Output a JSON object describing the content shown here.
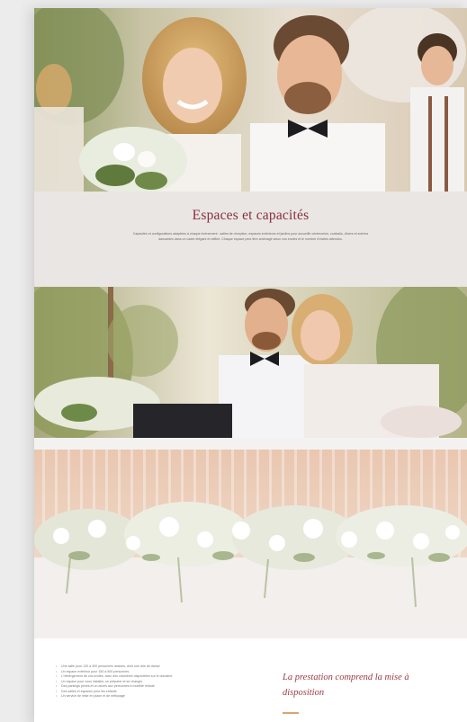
{
  "section": {
    "title": "Espaces et capacités",
    "description": "Capacités et configurations adaptées à chaque événement : salles de réception, espaces extérieurs et jardins pour accueillir cérémonies, cocktails, dîners et soirées dansantes dans un cadre élégant et raffiné. Chaque espace peut être aménagé selon vos envies et le nombre d'invités attendus."
  },
  "services": {
    "items": [
      "Une salle pour 120 à 300 personnes assises, dont une aire de danse",
      "Un espace extérieur pour 150 à 500 personnes",
      "L'hébergement de vos invités, avec des chambres disponibles sur le domaine",
      "Un espace pour vous installer, se préparer et se changer",
      "Des parkings privés et un accès aux personnes à mobilité réduite",
      "Des salles et espaces pour les enfants",
      "Un service de mise en place et de nettoyage"
    ],
    "heading": "La prestation comprend la mise à disposition"
  },
  "colors": {
    "title": "#8a2e3a",
    "band_background": "#e9e6e4",
    "accent_line": "#d8a56e"
  }
}
